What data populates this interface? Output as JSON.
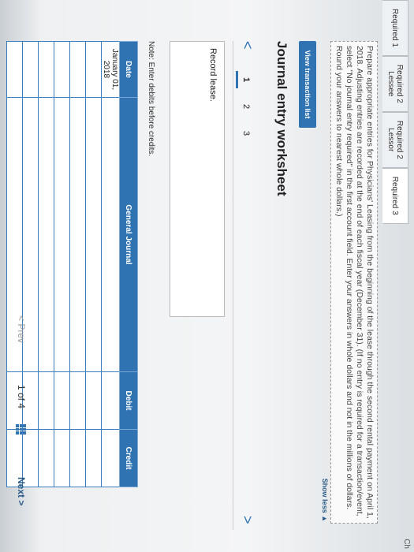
{
  "tabs": [
    {
      "line1": "Required 1",
      "line2": "",
      "active": false
    },
    {
      "line1": "Required 2",
      "line2": "Lessee",
      "active": false
    },
    {
      "line1": "Required 2",
      "line2": "Lessor",
      "active": false
    },
    {
      "line1": "Required 3",
      "line2": "",
      "active": true
    }
  ],
  "tab_corner": "Ch",
  "instructions": "Prepare appropriate entries for Physicians' Leasing from the beginning of the lease through the second rental payment on April 1, 2018. Adjusting entries are recorded at the end of each fiscal year (December 31). (If no entry is required for a transaction/event, select \"No journal entry required\" in the first account field. Enter your answers in whole dollars and not in the millions of dollars. Round your answers to nearest whole dollars.)",
  "show_less": "Show less ▲",
  "view_transaction_list": "View transaction list",
  "worksheet_title": "Journal entry worksheet",
  "pager": {
    "prev": "<",
    "next": ">",
    "pages": [
      "1",
      "2",
      "3"
    ],
    "active": "1"
  },
  "record_text": "Record lease.",
  "note": "Note: Enter debits before credits.",
  "table": {
    "headers": {
      "date": "Date",
      "journal": "General Journal",
      "debit": "Debit",
      "credit": "Credit"
    },
    "rows": [
      {
        "date": "January 01, 2018"
      },
      {
        "date": ""
      },
      {
        "date": ""
      },
      {
        "date": ""
      },
      {
        "date": ""
      },
      {
        "date": ""
      },
      {
        "date": ""
      }
    ]
  },
  "footer": {
    "prev": "< Prev",
    "page": "1 of 4",
    "next": "Next >"
  }
}
